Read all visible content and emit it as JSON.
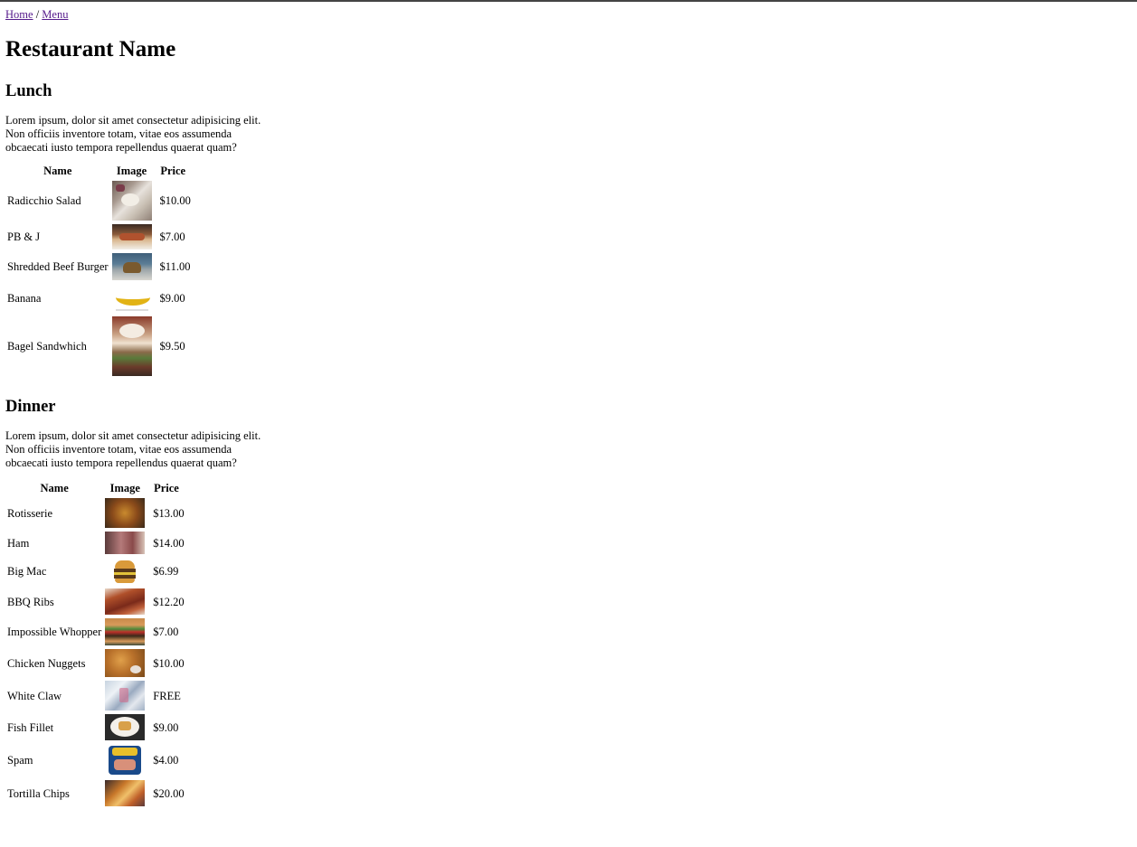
{
  "breadcrumb": {
    "home": "Home",
    "separator": " / ",
    "menu": "Menu"
  },
  "restaurant_name": "Restaurant Name",
  "table_headers": {
    "name": "Name",
    "image": "Image",
    "price": "Price"
  },
  "lunch": {
    "title": "Lunch",
    "description": "Lorem ipsum, dolor sit amet consectetur adipisicing elit. Non officiis inventore totam, vitae eos assumenda obcaecati iusto tempora repellendus quaerat quam?",
    "items": [
      {
        "name": "Radicchio Salad",
        "price": "$10.00"
      },
      {
        "name": "PB & J",
        "price": "$7.00"
      },
      {
        "name": "Shredded Beef Burger",
        "price": "$11.00"
      },
      {
        "name": "Banana",
        "price": "$9.00"
      },
      {
        "name": "Bagel Sandwhich",
        "price": "$9.50"
      }
    ]
  },
  "dinner": {
    "title": "Dinner",
    "description": "Lorem ipsum, dolor sit amet consectetur adipisicing elit. Non officiis inventore totam, vitae eos assumenda obcaecati iusto tempora repellendus quaerat quam?",
    "items": [
      {
        "name": "Rotisserie",
        "price": "$13.00"
      },
      {
        "name": "Ham",
        "price": "$14.00"
      },
      {
        "name": "Big Mac",
        "price": "$6.99"
      },
      {
        "name": "BBQ Ribs",
        "price": "$12.20"
      },
      {
        "name": "Impossible Whopper",
        "price": "$7.00"
      },
      {
        "name": "Chicken Nuggets",
        "price": "$10.00"
      },
      {
        "name": "White Claw",
        "price": "FREE"
      },
      {
        "name": "Fish Fillet",
        "price": "$9.00"
      },
      {
        "name": "Spam",
        "price": "$4.00"
      },
      {
        "name": "Tortilla Chips",
        "price": "$20.00"
      }
    ]
  },
  "colors": {
    "link_visited": "#551a8b",
    "top_border": "#444444"
  }
}
